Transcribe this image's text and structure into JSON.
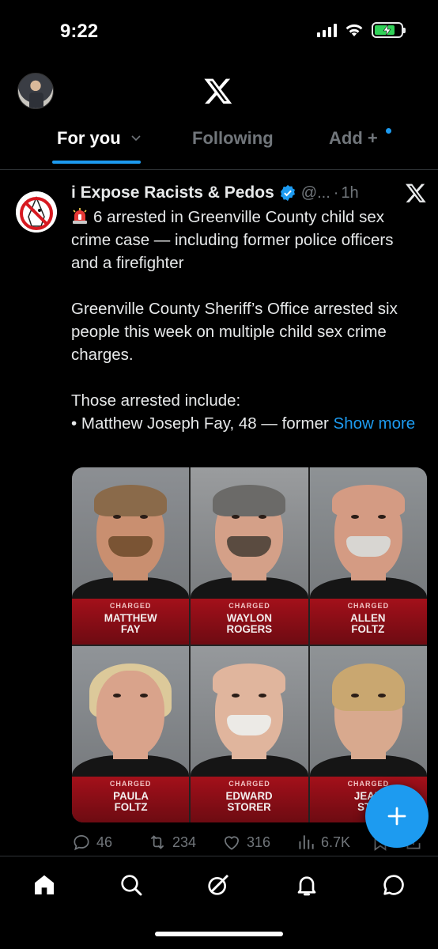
{
  "status_bar": {
    "time": "9:22"
  },
  "header": {
    "logo": "X",
    "tabs": [
      {
        "label": "For you",
        "active": true,
        "has_chevron": true
      },
      {
        "label": "Following",
        "active": false
      },
      {
        "label": "Add +",
        "active": false,
        "has_dot": true
      }
    ]
  },
  "post": {
    "author": "i Expose Racists & Pedos",
    "handle": "@...",
    "separator": "·",
    "time": "1h",
    "paragraphs": [
      "6 arrested in Greenville County child sex crime case — including former police officers and a firefighter",
      "Greenville County Sheriff’s Office arrested six people this week on multiple child sex crime charges."
    ],
    "list_intro": "Those arrested include:",
    "list_first": "• Matthew Joseph Fay, 48 — former ",
    "show_more": "Show more",
    "media": [
      {
        "tag": "CHARGED",
        "name": "MATTHEW\nFAY",
        "hair": "#8a6a4a",
        "skin": "#c98f70",
        "beard": "#7a5434",
        "bg": "#8c8f93"
      },
      {
        "tag": "CHARGED",
        "name": "WAYLON\nROGERS",
        "hair": "#6b6a68",
        "skin": "#d4a088",
        "beard": "#5a4b40",
        "bg": "#9a9c9e"
      },
      {
        "tag": "CHARGED",
        "name": "ALLEN\nFOLTZ",
        "hair": "#d49b83",
        "skin": "#d49b83",
        "beard": "#d8d6d2",
        "bg": "#8e9295"
      },
      {
        "tag": "CHARGED",
        "name": "PAULA\nFOLTZ",
        "hair": "#dcc99a",
        "skin": "#d9a38b",
        "beard": "",
        "bg": "#909498"
      },
      {
        "tag": "CHARGED",
        "name": "EDWARD\nSTORER",
        "hair": "#e0b59d",
        "skin": "#e0b59d",
        "beard": "#eceae6",
        "bg": "#96999c"
      },
      {
        "tag": "CHARGED",
        "name": "JEAN\nSTO",
        "hair": "#c9a770",
        "skin": "#d8a98e",
        "beard": "",
        "bg": "#8f9396"
      }
    ],
    "stats": {
      "replies": "46",
      "reposts": "234",
      "likes": "316",
      "views": "6.7K"
    }
  },
  "colors": {
    "accent": "#1d9bf0",
    "muted": "#71767b",
    "text": "#e7e9ea",
    "banner_red": "#a3101a"
  },
  "bottom_nav": [
    "home-icon",
    "search-icon",
    "grok-icon",
    "notifications-icon",
    "messages-icon"
  ]
}
